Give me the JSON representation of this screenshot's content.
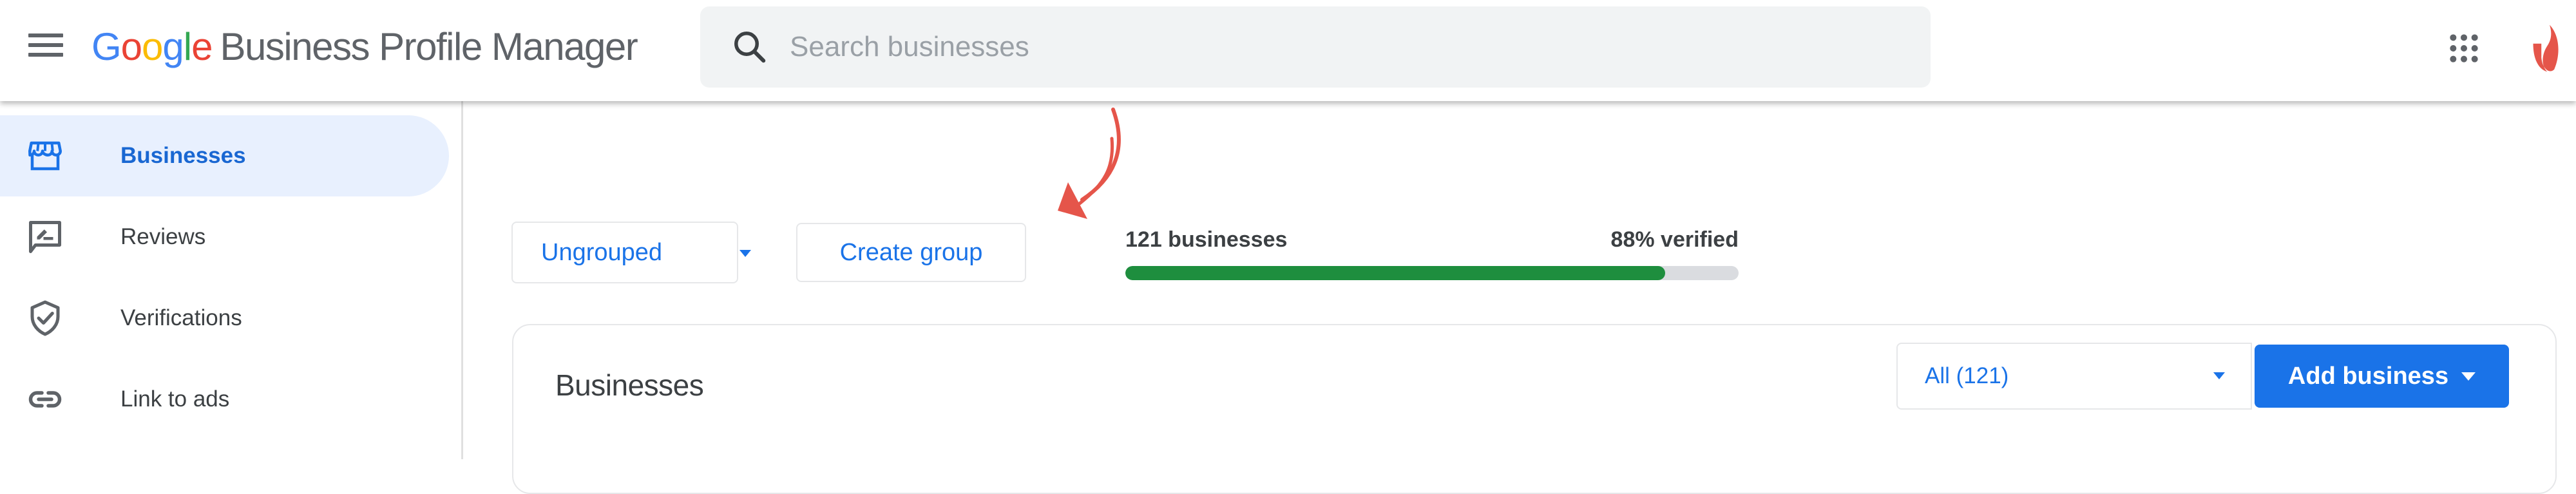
{
  "header": {
    "logo_letters": [
      "G",
      "o",
      "o",
      "g",
      "l",
      "e"
    ],
    "product_name": "Business Profile Manager",
    "search": {
      "placeholder": "Search businesses",
      "value": ""
    },
    "icons": {
      "menu": "hamburger-menu-icon",
      "search": "search-icon",
      "apps": "google-apps-grid-icon",
      "account": "account-avatar-icon"
    }
  },
  "sidebar": {
    "items": [
      {
        "label": "Businesses",
        "icon": "storefront-icon",
        "active": true
      },
      {
        "label": "Reviews",
        "icon": "rate-review-icon",
        "active": false
      },
      {
        "label": "Verifications",
        "icon": "verified-shield-icon",
        "active": false
      },
      {
        "label": "Link to ads",
        "icon": "link-icon",
        "active": false
      }
    ]
  },
  "toolbar": {
    "group_select": {
      "selected": "Ungrouped"
    },
    "create_group_label": "Create group"
  },
  "stats": {
    "businesses_count_label": "121 businesses",
    "verified_label": "88% verified",
    "verified_fraction": 0.88
  },
  "colors": {
    "accent_blue": "#1a73e8",
    "active_nav_bg": "#e8f0fe",
    "progress_green": "#1e8e3e",
    "progress_track": "#dadce0",
    "annotation_red": "#e5554a"
  },
  "businesses_card": {
    "title": "Businesses",
    "filter_select": {
      "selected": "All (121)"
    },
    "add_business_label": "Add business"
  }
}
